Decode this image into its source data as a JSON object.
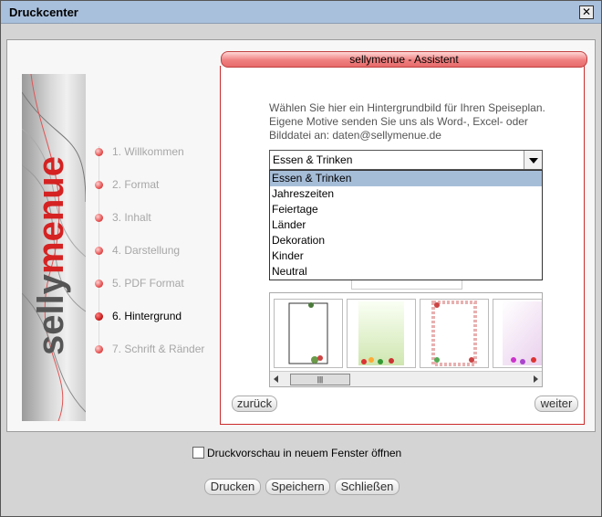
{
  "window": {
    "title": "Druckcenter",
    "close_glyph": "✕"
  },
  "banner": {
    "brand_part1": "selly",
    "brand_part2": "menue"
  },
  "steps": [
    {
      "label": "1. Willkommen",
      "active": false
    },
    {
      "label": "2. Format",
      "active": false
    },
    {
      "label": "3. Inhalt",
      "active": false
    },
    {
      "label": "4. Darstellung",
      "active": false
    },
    {
      "label": "5. PDF Format",
      "active": false
    },
    {
      "label": "6. Hintergrund",
      "active": true
    },
    {
      "label": "7. Schrift & Ränder",
      "active": false
    }
  ],
  "assistant": {
    "title": "sellymenue - Assistent",
    "description": "Wählen Sie hier ein Hintergrundbild für Ihren Speiseplan. Eigene Motive senden Sie uns als Word-, Excel- oder Bilddatei an: daten@sellymenue.de",
    "select": {
      "value": "Essen & Trinken",
      "options": [
        "Essen & Trinken",
        "Jahreszeiten",
        "Feiertage",
        "Länder",
        "Dekoration",
        "Kinder",
        "Neutral"
      ],
      "selected_index": 0
    },
    "back_label": "zurück",
    "next_label": "weiter"
  },
  "footer": {
    "preview_checkbox_label": "Druckvorschau in neuem Fenster öffnen",
    "preview_checked": false,
    "print_label": "Drucken",
    "save_label": "Speichern",
    "close_label": "Schließen"
  },
  "colors": {
    "accent": "#cc2b2b",
    "titlebar": "#a9c0dc",
    "selected_option": "#a6bdd8"
  }
}
